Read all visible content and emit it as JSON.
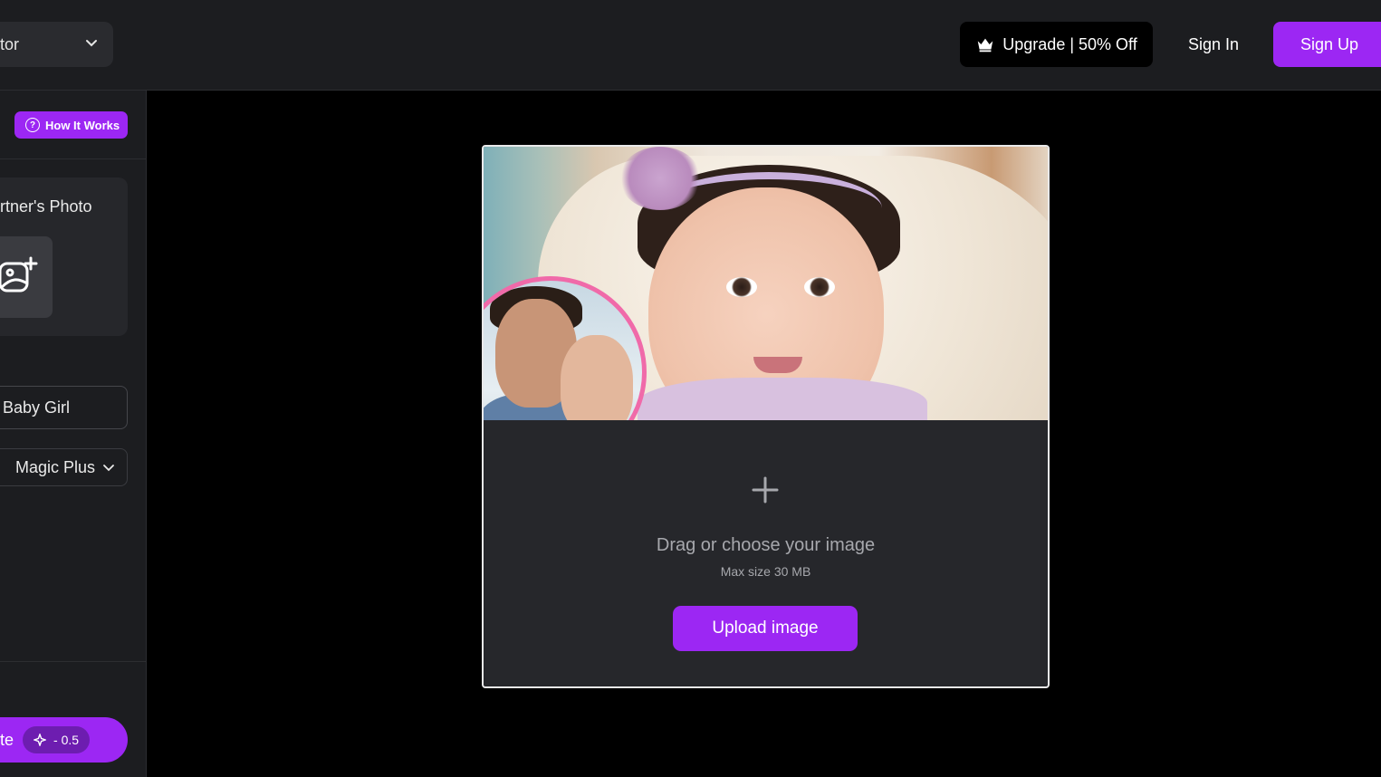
{
  "header": {
    "tool_select_label": "tor",
    "upgrade_label": "Upgrade | 50% Off",
    "signin_label": "Sign In",
    "signup_label": "Sign Up"
  },
  "sidebar": {
    "how_it_works_label": "How It Works",
    "partner_photo_title": "rtner's Photo",
    "gender_value": "Baby Girl",
    "model_value": "Magic Plus",
    "generate_label": "te",
    "cost_value": "- 0.5"
  },
  "upload": {
    "title": "Drag or choose your image",
    "subtitle": "Max size 30 MB",
    "button_label": "Upload image"
  },
  "colors": {
    "accent": "#9c27f3",
    "panel": "#26272b",
    "background": "#000000",
    "header": "#1c1d20"
  }
}
